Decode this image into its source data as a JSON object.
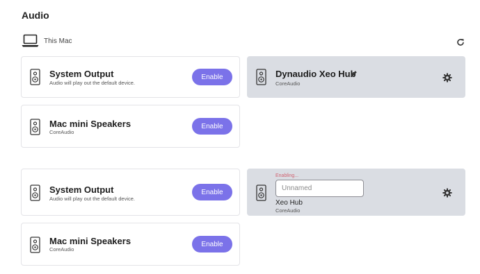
{
  "page": {
    "title": "Audio"
  },
  "host": {
    "icon": "laptop-icon",
    "label": "This Mac",
    "refresh_icon": "refresh-icon"
  },
  "section1": {
    "devices": [
      {
        "title": "System Output",
        "subtitle": "Audio will play out the default device.",
        "button": "Enable",
        "icon": "speaker-icon"
      },
      {
        "title": "Mac mini Speakers",
        "subtitle": "CoreAudio",
        "button": "Enable",
        "icon": "speaker-icon"
      }
    ],
    "selected": {
      "title": "Dynaudio Xeo Hub",
      "subtitle": "CoreAudio",
      "edit_icon": "pencil-icon",
      "settings_icon": "gear-icon"
    }
  },
  "section2": {
    "devices": [
      {
        "title": "System Output",
        "subtitle": "Audio will play out the default device.",
        "button": "Enable",
        "icon": "speaker-icon"
      },
      {
        "title": "Mac mini Speakers",
        "subtitle": "CoreAudio",
        "button": "Enable",
        "icon": "speaker-icon"
      }
    ],
    "selected": {
      "status": "Enabling...",
      "name_placeholder": "Unnamed",
      "name_value": "",
      "device_name": "Xeo Hub",
      "subtitle": "CoreAudio",
      "settings_icon": "gear-icon"
    }
  },
  "colors": {
    "accent": "#7b72e9",
    "selected_bg": "#dadde3",
    "status": "#d06270"
  }
}
